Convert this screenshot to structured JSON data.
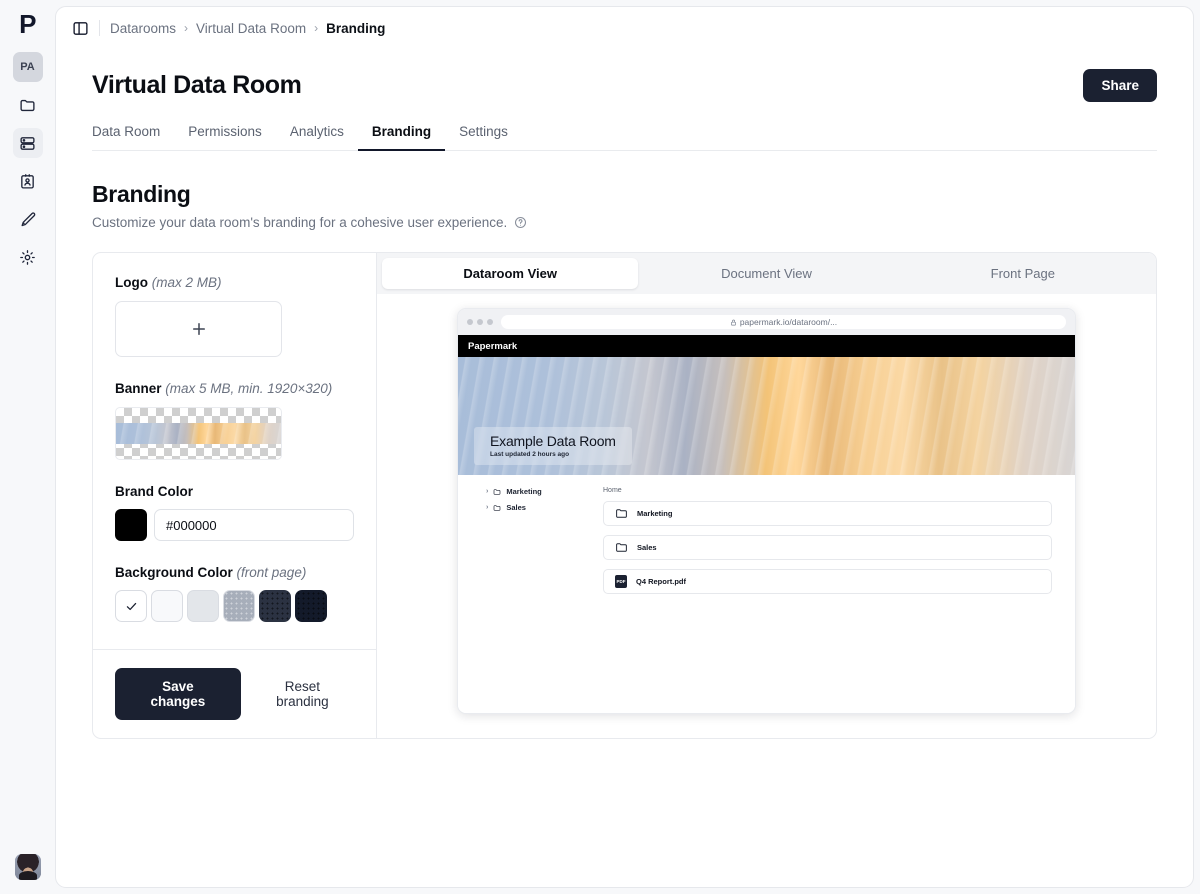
{
  "rail": {
    "logo": "P",
    "account_chip": "PA",
    "items": [
      {
        "icon": "folder-icon",
        "name": "documents"
      },
      {
        "icon": "datarooms-icon",
        "name": "datarooms",
        "active": true
      },
      {
        "icon": "contacts-icon",
        "name": "visitors"
      },
      {
        "icon": "branding-brush-icon",
        "name": "branding"
      },
      {
        "icon": "gear-icon",
        "name": "settings"
      }
    ]
  },
  "topbar": {
    "panel_toggle_icon": "sidebar-toggle-icon",
    "breadcrumb": [
      {
        "label": "Datarooms",
        "current": false
      },
      {
        "label": "Virtual Data Room",
        "current": false
      },
      {
        "label": "Branding",
        "current": true
      }
    ],
    "separator": "›"
  },
  "header": {
    "title": "Virtual Data Room",
    "share_label": "Share"
  },
  "tabs": [
    {
      "label": "Data Room",
      "active": false
    },
    {
      "label": "Permissions",
      "active": false
    },
    {
      "label": "Analytics",
      "active": false
    },
    {
      "label": "Branding",
      "active": true
    },
    {
      "label": "Settings",
      "active": false
    }
  ],
  "section": {
    "title": "Branding",
    "subtitle": "Customize your data room's branding for a cohesive user experience.",
    "help_icon": "help-circle-icon"
  },
  "form": {
    "logo": {
      "label": "Logo",
      "hint": "(max 2 MB)",
      "upload_icon": "plus-icon"
    },
    "banner": {
      "label": "Banner",
      "hint": "(max 5 MB, min. 1920×320)"
    },
    "brand_color": {
      "label": "Brand Color",
      "value": "#000000",
      "placeholder": "#000000",
      "swatch": "#000000"
    },
    "background_color": {
      "label": "Background Color",
      "hint": "(front page)",
      "selected_index": 0,
      "check_icon": "check-icon",
      "options": [
        {
          "hex": "#ffffff",
          "selected": true
        },
        {
          "hex": "#f8f9fb",
          "selected": false
        },
        {
          "hex": "#e3e6ea",
          "selected": false
        },
        {
          "hex": "#a7aeba",
          "selected": false
        },
        {
          "hex": "#2b3242",
          "selected": false
        },
        {
          "hex": "#131a2a",
          "selected": false
        }
      ]
    },
    "save_label": "Save changes",
    "reset_label": "Reset branding"
  },
  "preview": {
    "tabs": [
      {
        "label": "Dataroom View",
        "active": true
      },
      {
        "label": "Document View",
        "active": false
      },
      {
        "label": "Front Page",
        "active": false
      }
    ],
    "browser": {
      "lock_icon": "lock-icon",
      "url": "papermark.io/dataroom/...",
      "brand_header": "Papermark",
      "hero_title": "Example Data Room",
      "hero_subtitle": "Last updated 2 hours ago",
      "tree": [
        {
          "label": "Marketing",
          "icon": "folder-icon",
          "chevron": "›"
        },
        {
          "label": "Sales",
          "icon": "folder-icon",
          "chevron": "›"
        }
      ],
      "home_label": "Home",
      "files": [
        {
          "name": "Marketing",
          "type": "folder"
        },
        {
          "name": "Sales",
          "type": "folder"
        },
        {
          "name": "Q4 Report.pdf",
          "type": "pdf",
          "badge": "PDF"
        }
      ]
    }
  }
}
